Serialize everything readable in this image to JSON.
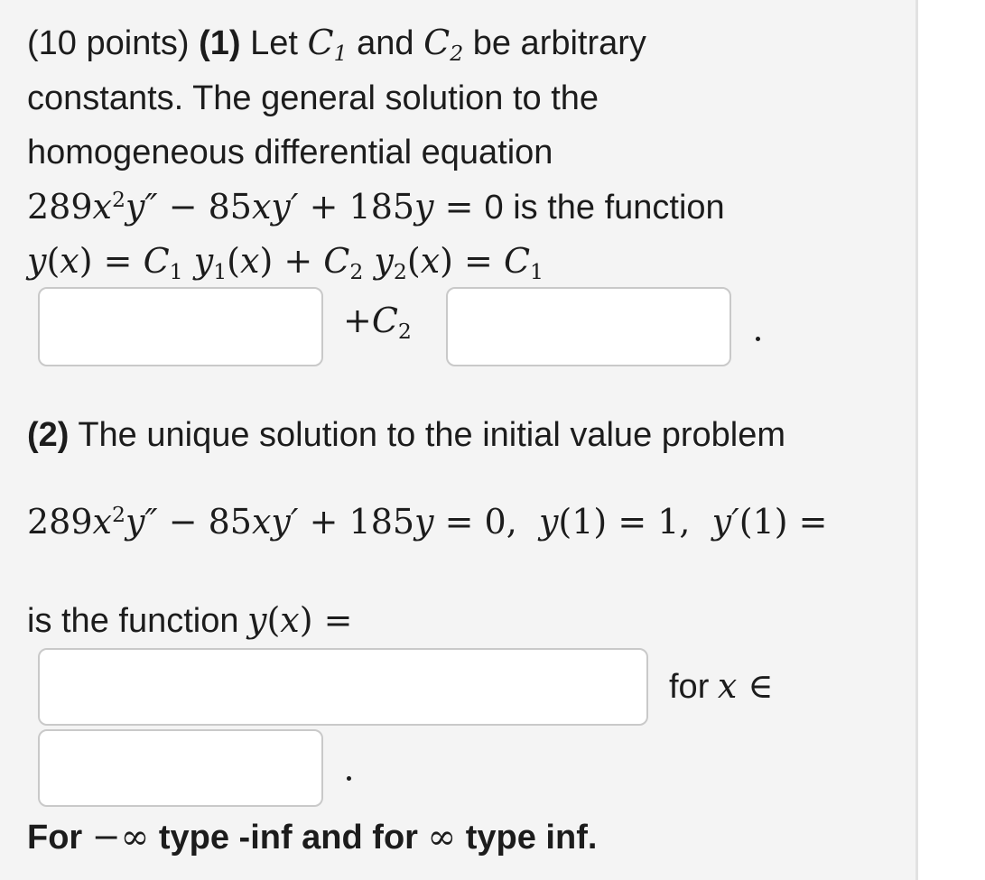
{
  "problem": {
    "header": "(10 points)",
    "part1_label": "(1)",
    "part1_line1_pre": "Let",
    "part1_line1_mid": "and",
    "part1_line1_post": "be arbitrary",
    "part1_line2": "constants. The general solution to the",
    "part1_line3": "homogeneous differential equation",
    "equation_text": "is the function",
    "part2_label": "(2)",
    "part2_text": "The unique solution to the initial value problem",
    "part2_is_the_function": "is the function",
    "for_x_in": "for",
    "footer_bold": "For",
    "footer_mid": "type -inf and for",
    "footer_end": "type inf."
  },
  "math": {
    "c1": "C",
    "c2": "C",
    "sub1": "1",
    "sub2": "2",
    "coef_a": "289",
    "coef_b": "85",
    "coef_c": "185",
    "x": "x",
    "y": "y",
    "two": "2",
    "ivp_y1": "1",
    "ivp_yp1": "1"
  },
  "inputs": {
    "y1": "",
    "y2": "",
    "solution": "",
    "interval": ""
  }
}
